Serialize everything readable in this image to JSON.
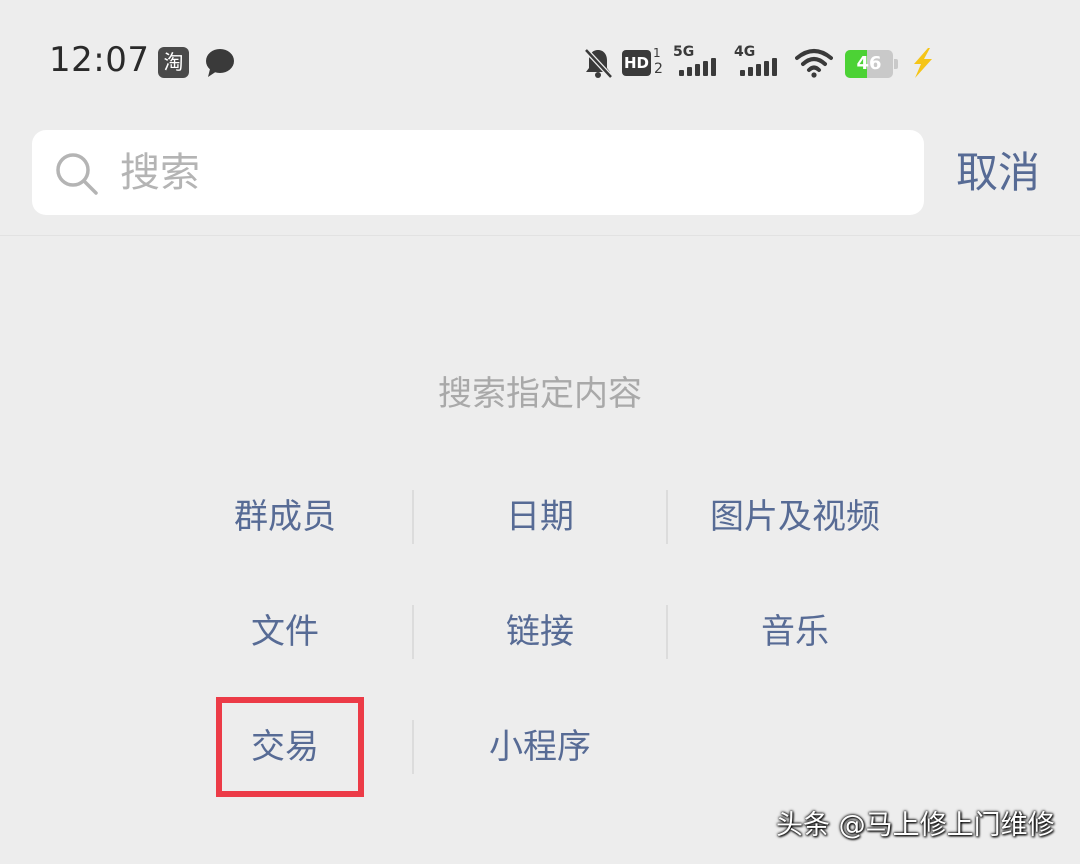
{
  "status_bar": {
    "time": "12:07",
    "taobao_badge": "淘",
    "hd_label": "HD",
    "hd_sup": "1",
    "hd_sub": "2",
    "network_5g": "5G",
    "network_4g": "4G",
    "battery_level": "46",
    "battery_fraction": 0.46,
    "colors": {
      "battery_fill": "#4cd235",
      "charge_bolt": "#f5c518"
    },
    "icons": [
      "taobao-icon",
      "chat-icon",
      "mute-icon",
      "hd-voice-icon",
      "signal-icon",
      "wifi-icon",
      "battery-icon",
      "charging-icon"
    ]
  },
  "search": {
    "placeholder": "搜索",
    "cancel_label": "取消",
    "icon": "search-icon"
  },
  "content": {
    "title": "搜索指定内容",
    "items": [
      {
        "label": "群成员"
      },
      {
        "label": "日期"
      },
      {
        "label": "图片及视频"
      },
      {
        "label": "文件"
      },
      {
        "label": "链接"
      },
      {
        "label": "音乐"
      },
      {
        "label": "交易"
      },
      {
        "label": "小程序"
      }
    ]
  },
  "watermark": "头条 @马上修上门维修",
  "colors": {
    "background": "#ededed",
    "link": "#576b95",
    "hint": "#a9a9a9",
    "highlight": "#ec3b47"
  }
}
